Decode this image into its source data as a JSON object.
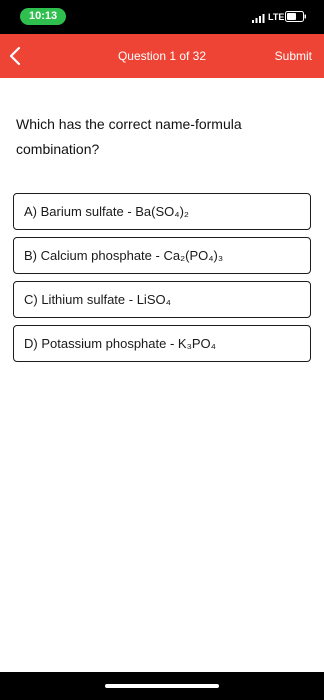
{
  "status_bar": {
    "time": "10:13",
    "network": "LTE",
    "icons": [
      "signal-icon",
      "battery-icon"
    ],
    "time_pill_color": "#2fbf4f"
  },
  "header": {
    "title": "Question 1 of 32",
    "submit_label": "Submit",
    "back_icon": "chevron-left-icon",
    "background_color": "#ee4436"
  },
  "question": {
    "text": "Which has the correct name-formula combination?"
  },
  "options": [
    {
      "label": "A) Barium sulfate - Ba(SO₄)₂"
    },
    {
      "label": "B) Calcium phosphate - Ca₂(PO₄)₃"
    },
    {
      "label": "C) Lithium sulfate - LiSO₄"
    },
    {
      "label": "D) Potassium phosphate - K₃PO₄"
    }
  ]
}
